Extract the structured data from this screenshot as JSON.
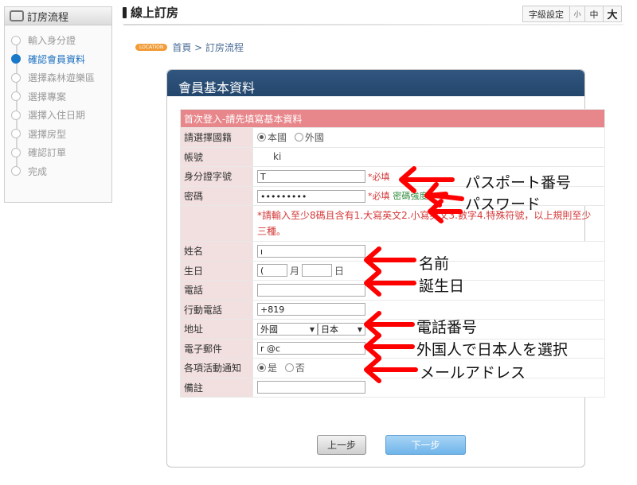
{
  "sidebar": {
    "title": "訂房流程",
    "steps": [
      {
        "label": "輸入身分證",
        "active": false
      },
      {
        "label": "確認會員資料",
        "active": true
      },
      {
        "label": "選擇森林遊樂區",
        "active": false
      },
      {
        "label": "選擇專案",
        "active": false
      },
      {
        "label": "選擇入住日期",
        "active": false
      },
      {
        "label": "選擇房型",
        "active": false
      },
      {
        "label": "確認訂單",
        "active": false
      },
      {
        "label": "完成",
        "active": false
      }
    ]
  },
  "header": {
    "title": "線上訂房",
    "font_size_label": "字級設定",
    "font_small": "小",
    "font_medium": "中",
    "font_large": "大"
  },
  "breadcrumb": {
    "badge": "LOCATION",
    "path": "首頁 > 訂房流程"
  },
  "panel": {
    "title": "會員基本資料",
    "caption": "首次登入-請先填寫基本資料"
  },
  "form": {
    "nationality": {
      "label": "請選擇國籍",
      "option_local": "本國",
      "option_foreign": "外國",
      "selected": "外國"
    },
    "account": {
      "label": "帳號",
      "value": "ki"
    },
    "id_number": {
      "label": "身分證字號",
      "value": "T",
      "required": "*必填"
    },
    "password": {
      "label": "密碼",
      "value": "•••••••••",
      "required": "*必填",
      "strength_label": "密碼強度"
    },
    "password_rule": "*請輸入至少8碼且含有1.大寫英文2.小寫英文3.數字4.特殊符號，以上規則至少三種。",
    "name": {
      "label": "姓名",
      "value": "ı"
    },
    "birthday": {
      "label": "生日",
      "year": "(",
      "month_label": "月",
      "day_label": "日"
    },
    "phone": {
      "label": "電話",
      "value": ""
    },
    "mobile": {
      "label": "行動電話",
      "value": "+819"
    },
    "address": {
      "label": "地址",
      "country": "外國",
      "region": "日本"
    },
    "email": {
      "label": "電子郵件",
      "value": "r        @c"
    },
    "notify": {
      "label": "各項活動通知",
      "yes": "是",
      "no": "否",
      "selected": "是"
    },
    "memo": {
      "label": "備註",
      "value": ""
    }
  },
  "buttons": {
    "prev": "上一步",
    "next": "下一步"
  },
  "annotations": {
    "passport": "パスポート番号",
    "password": "パスワード",
    "name": "名前",
    "birthday": "誕生日",
    "phone": "電話番号",
    "foreigner": "外国人で日本人を選択",
    "email": "メールアドレス",
    "arrow_color": "#ff0000"
  }
}
